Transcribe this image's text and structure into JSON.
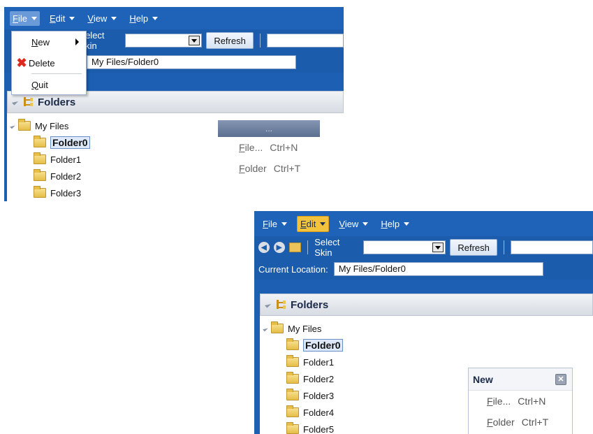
{
  "menubar": {
    "file": {
      "first": "F",
      "rest": "ile"
    },
    "edit": {
      "first": "E",
      "rest": "dit"
    },
    "view": {
      "first": "V",
      "rest": "iew"
    },
    "help": {
      "first": "H",
      "rest": "elp"
    }
  },
  "toolbar": {
    "select_skin_label": "Select Skin",
    "refresh_label": "Refresh"
  },
  "location": {
    "label": "Current Location:",
    "short_label": ":",
    "value": "My Files/Folder0"
  },
  "folders_panel": {
    "title": "Folders",
    "root": "My Files",
    "items_top": [
      "Folder0",
      "Folder1",
      "Folder2",
      "Folder3"
    ],
    "items_bottom": [
      "Folder0",
      "Folder1",
      "Folder2",
      "Folder3",
      "Folder4",
      "Folder5"
    ]
  },
  "file_menu": {
    "new": {
      "first": "N",
      "rest": "ew"
    },
    "delete": "Delete",
    "quit": {
      "first": "Q",
      "rest": "uit"
    }
  },
  "context_popup": {
    "header": "...",
    "file": {
      "first": "F",
      "rest": "ile...",
      "shortcut": "Ctrl+N"
    },
    "folder": {
      "first": "F",
      "rest": "older",
      "shortcut": "Ctrl+T"
    }
  },
  "new_popup": {
    "title": "New",
    "file": {
      "first": "F",
      "rest": "ile...",
      "shortcut": "Ctrl+N"
    },
    "folder": {
      "first": "F",
      "rest": "older",
      "shortcut": "Ctrl+T"
    }
  },
  "colors": {
    "chrome_blue": "#1e63b8",
    "edit_highlight": "#f3c33d",
    "folder_yellow": "#e6be48"
  }
}
